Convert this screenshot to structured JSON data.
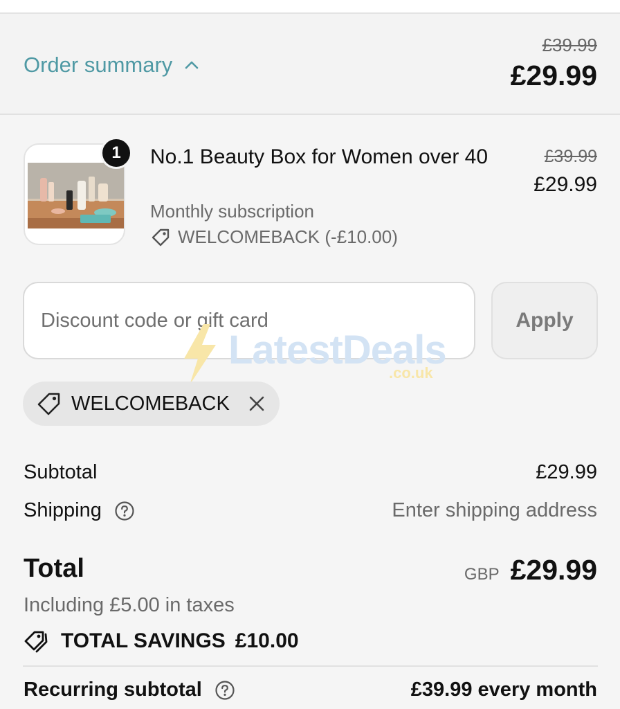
{
  "summary": {
    "toggle_label": "Order summary",
    "original_price": "£39.99",
    "price": "£29.99"
  },
  "product": {
    "quantity": "1",
    "title": "No.1 Beauty Box for Women over 40",
    "subtitle": "Monthly subscription",
    "applied_discount": "WELCOMEBACK (-£10.00)",
    "original_price": "£39.99",
    "price": "£29.99"
  },
  "discount": {
    "placeholder": "Discount code or gift card",
    "value": "",
    "apply_label": "Apply"
  },
  "watermark": {
    "text": "LatestDeals",
    "sub": ".co.uk"
  },
  "applied_code": {
    "code": "WELCOMEBACK"
  },
  "totals": {
    "subtotal_label": "Subtotal",
    "subtotal_value": "£29.99",
    "shipping_label": "Shipping",
    "shipping_value": "Enter shipping address",
    "total_label": "Total",
    "currency": "GBP",
    "total_value": "£29.99",
    "taxes_note": "Including £5.00 in taxes",
    "savings_label": "TOTAL SAVINGS",
    "savings_value": "£10.00",
    "recurring_label": "Recurring subtotal",
    "recurring_value": "£39.99 every month"
  },
  "colors": {
    "accent": "#4f99a4",
    "text": "#111111",
    "muted": "#6a6a6a",
    "background": "#f5f5f5"
  },
  "icons": {
    "toggle": "chevron-up-icon",
    "discount_tag": "tag-icon",
    "remove_code": "close-icon",
    "help": "help-circle-icon",
    "savings": "tags-icon"
  }
}
